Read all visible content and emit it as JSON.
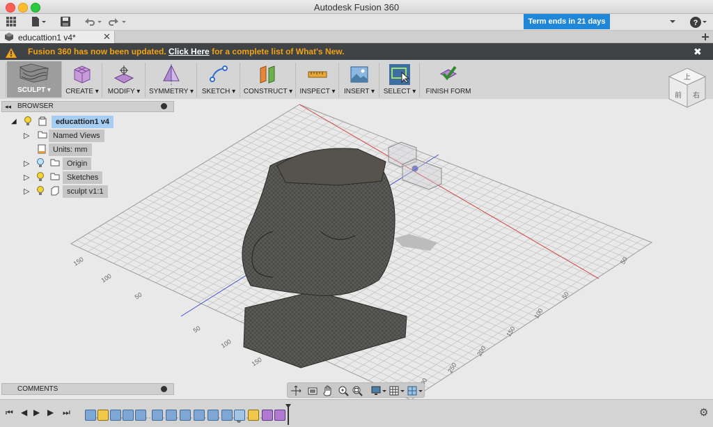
{
  "window": {
    "title": "Autodesk Fusion 360"
  },
  "qat": {
    "term_badge": "Term ends in 21 days"
  },
  "doc_tab": {
    "label": "educattion1 v4*"
  },
  "banner": {
    "text_before": "Fusion 360 has now been updated. ",
    "link": "Click Here",
    "text_after": " for a complete list of What's New."
  },
  "toolbar": {
    "groups": [
      {
        "label": "SCULPT ▾",
        "icon": "sculpt-workspace-icon"
      },
      {
        "label": "CREATE ▾",
        "icon": "create-box-icon"
      },
      {
        "label": "MODIFY ▾",
        "icon": "modify-icon"
      },
      {
        "label": "SYMMETRY ▾",
        "icon": "symmetry-icon"
      },
      {
        "label": "SKETCH ▾",
        "icon": "sketch-icon"
      },
      {
        "label": "CONSTRUCT ▾",
        "icon": "construct-plane-icon"
      },
      {
        "label": "INSPECT ▾",
        "icon": "inspect-measure-icon"
      },
      {
        "label": "INSERT ▾",
        "icon": "insert-image-icon"
      },
      {
        "label": "SELECT ▾",
        "icon": "select-window-icon"
      },
      {
        "label": "FINISH FORM",
        "icon": "finish-form-check-icon"
      }
    ]
  },
  "browser": {
    "title": "BROWSER",
    "root": "educattion1 v4",
    "items": [
      {
        "label": "Named Views",
        "has_bulb": false
      },
      {
        "label": "Units: mm",
        "has_bulb": false
      },
      {
        "label": "Origin",
        "has_bulb": true
      },
      {
        "label": "Sketches",
        "has_bulb": true
      },
      {
        "label": "sculpt v1:1",
        "has_bulb": true
      }
    ]
  },
  "viewcube": {
    "faces": [
      "上",
      "前",
      "右"
    ]
  },
  "grid_labels": {
    "left": [
      "150",
      "100",
      "50",
      "50",
      "100",
      "150"
    ],
    "right": [
      "50",
      "50",
      "100",
      "150",
      "200",
      "250",
      "300"
    ]
  },
  "comments": {
    "title": "COMMENTS"
  },
  "colors": {
    "accent": "#1f86d8",
    "banner_text": "#f0a315",
    "x_axis": "#d04040",
    "z_axis": "#4050d0"
  }
}
